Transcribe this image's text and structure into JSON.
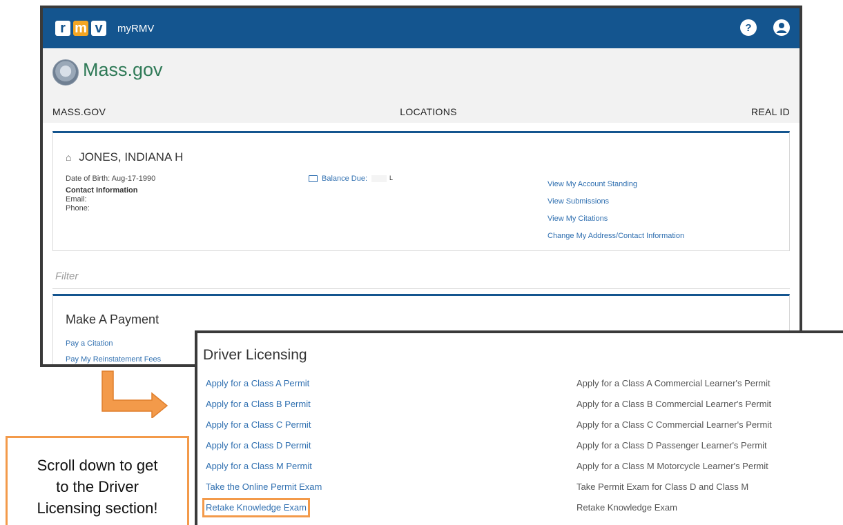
{
  "app": {
    "logo_letters": [
      "r",
      "m",
      "v"
    ],
    "title": "myRMV",
    "help_icon": "help-icon",
    "account_icon": "user-account-icon"
  },
  "massgov": {
    "wordmark": "Mass.gov",
    "nav": [
      "MASS.GOV",
      "LOCATIONS",
      "REAL ID"
    ]
  },
  "profile": {
    "name": "JONES, INDIANA H",
    "dob": "Date of Birth: Aug-17-1990",
    "contact_heading": "Contact Information",
    "email_label": "Email:",
    "phone_label": "Phone:",
    "balance_label": "Balance Due:",
    "balance_mark": "L",
    "links": [
      "View My Account Standing",
      "View Submissions",
      "View My Citations",
      "Change My Address/Contact Information"
    ]
  },
  "filter": {
    "placeholder": "Filter"
  },
  "payment": {
    "title": "Make A Payment",
    "links": [
      "Pay a Citation",
      "Pay My Reinstatement Fees"
    ]
  },
  "driver_licensing": {
    "title": "Driver Licensing",
    "links": [
      "Apply for a Class A Permit",
      "Apply for a Class B Permit",
      "Apply for a Class C Permit",
      "Apply for a Class D Permit",
      "Apply for a Class M Permit",
      "Take the Online Permit Exam",
      "Retake Knowledge Exam"
    ],
    "descriptions": [
      "Apply for a Class A Commercial Learner's Permit",
      "Apply for a Class B Commercial Learner's Permit",
      "Apply for a Class C Commercial Learner's Permit",
      "Apply for a Class D Passenger Learner's Permit",
      "Apply for a Class M Motorcycle Learner's Permit",
      "Take Permit Exam for Class D and Class M",
      "Retake Knowledge Exam"
    ]
  },
  "callout": {
    "lines": [
      "Scroll down to get",
      "to the Driver",
      "Licensing section!"
    ]
  },
  "colors": {
    "header_blue": "#14558f",
    "link_blue": "#2f6fb0",
    "highlight_orange": "#f39a4a",
    "massgov_green": "#2f7a57"
  }
}
